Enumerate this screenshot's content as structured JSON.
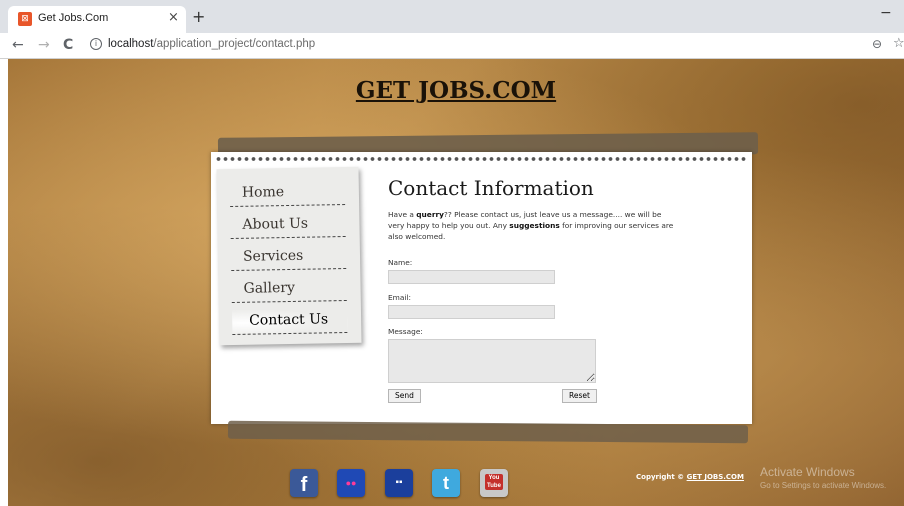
{
  "browser": {
    "tab_title": "Get Jobs.Com",
    "tab_close": "×",
    "new_tab": "+",
    "minimize": "−",
    "back": "←",
    "forward": "→",
    "reload": "C",
    "url_host": "localhost",
    "url_path": "/application_project/contact.php",
    "zoom_icon": "⊖",
    "star_icon": "☆"
  },
  "site": {
    "title": "GET JOBS.COM"
  },
  "menu": {
    "items": [
      {
        "label": "Home"
      },
      {
        "label": "About Us"
      },
      {
        "label": "Services"
      },
      {
        "label": "Gallery"
      },
      {
        "label": "Contact Us"
      }
    ]
  },
  "contact": {
    "title": "Contact Information",
    "intro_1": "Have a ",
    "intro_bold_1": "querry",
    "intro_2": "?? Please contact us, just leave us a message.... we will be very happy to help you out. Any ",
    "intro_bold_2": "suggestions",
    "intro_3": " for improving our services are also welcomed.",
    "name_label": "Name:",
    "name_value": "",
    "email_label": "Email:",
    "email_value": "",
    "message_label": "Message:",
    "message_value": "",
    "send_label": "Send",
    "reset_label": "Reset"
  },
  "footer": {
    "social": [
      {
        "icon": "facebook-icon",
        "glyph": "f",
        "color": "#3b5998"
      },
      {
        "icon": "flickr-icon",
        "glyph": "●●",
        "color": "#1f49b5"
      },
      {
        "icon": "myspace-icon",
        "glyph": "▪▪",
        "color": "#1b3f9c"
      },
      {
        "icon": "twitter-icon",
        "glyph": "t",
        "color": "#3fa9de"
      },
      {
        "icon": "youtube-icon",
        "glyph": "You Tube",
        "color": "#c8c8c8"
      }
    ],
    "copyright_prefix": "Copyright © ",
    "copyright_link": "GET JOBS.COM"
  },
  "watermark": {
    "line1": "Activate Windows",
    "line2": "Go to Settings to activate Windows."
  }
}
